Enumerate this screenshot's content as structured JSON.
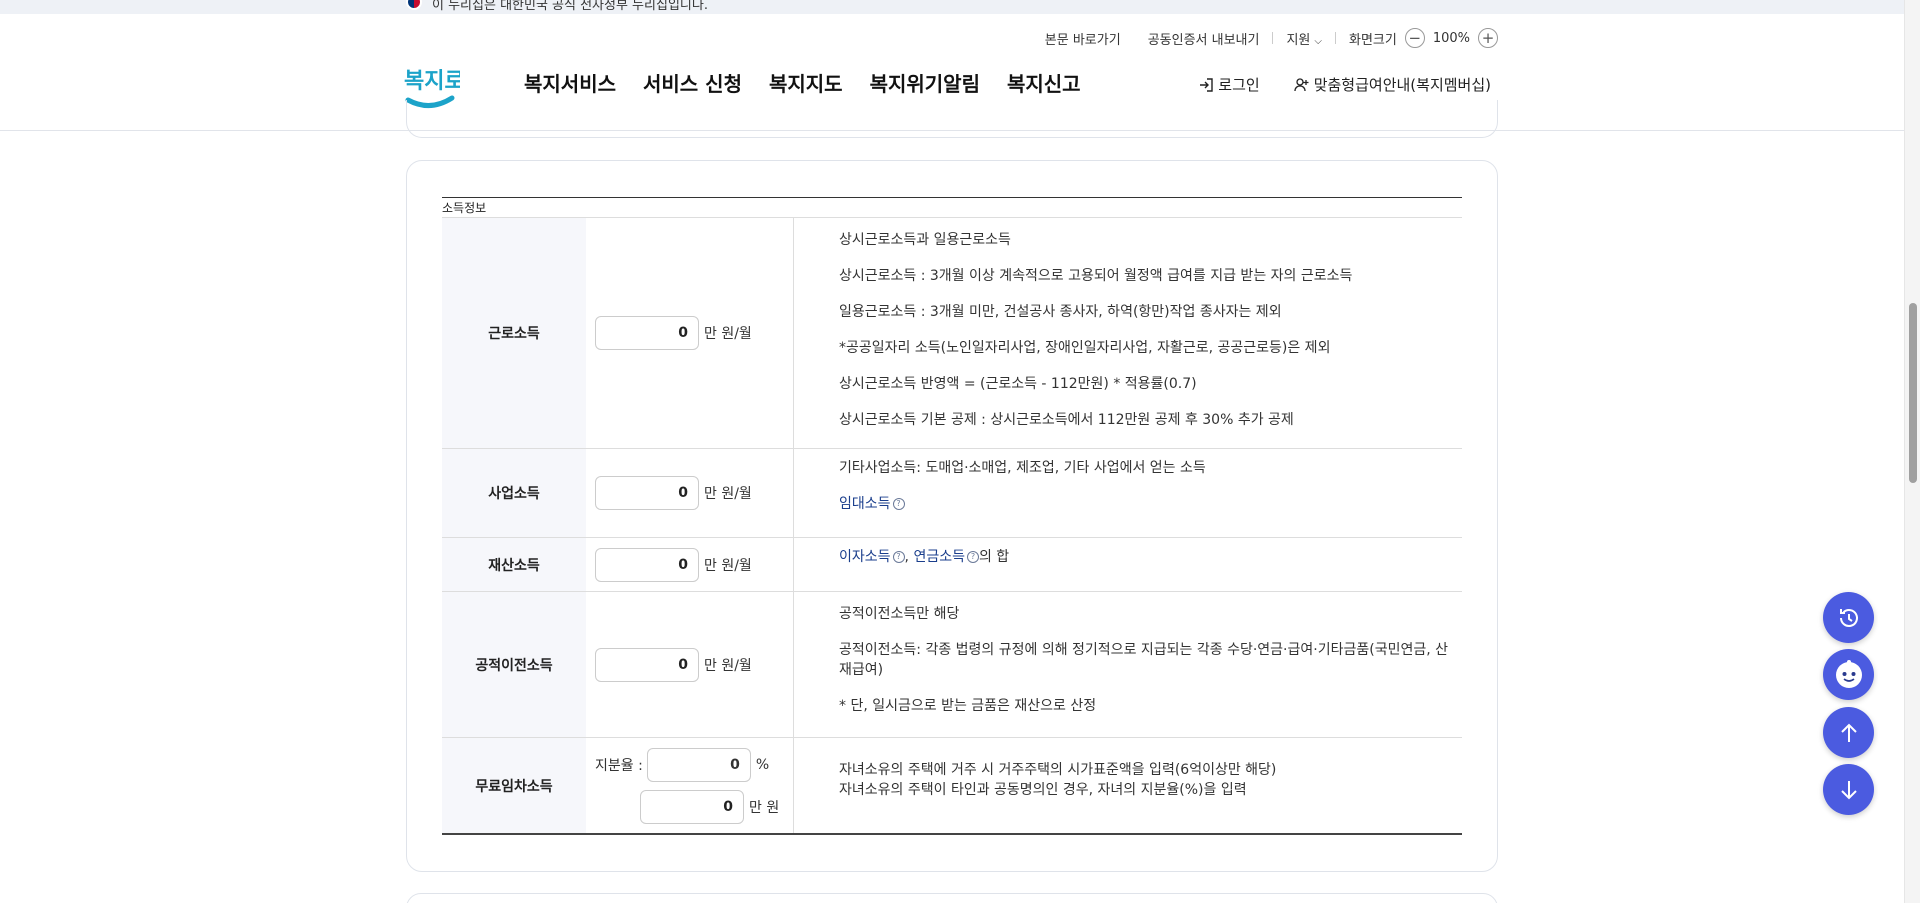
{
  "banner": {
    "text": "이 누리집은 대한민국 공식 전자정부 누리집입니다."
  },
  "util": {
    "skip_link": "본문 바로가기",
    "cert_export": "공동인증서 내보내기",
    "support": "지원",
    "zoom_label": "화면크기",
    "zoom_minus": "−",
    "zoom_value": "100%",
    "zoom_plus": "+"
  },
  "logo": {
    "text": "복지로"
  },
  "gnb": [
    {
      "label": "복지서비스"
    },
    {
      "label": "서비스 신청"
    },
    {
      "label": "복지지도"
    },
    {
      "label": "복지위기알림"
    },
    {
      "label": "복지신고"
    }
  ],
  "header_right": {
    "login": "로그인",
    "membership": "맞춤형급여안내(복지멤버십)"
  },
  "income": {
    "caption": "소득정보",
    "rows": [
      {
        "label": "근로소득",
        "value": "0",
        "unit": "만 원/월",
        "desc": [
          "상시근로소득과 일용근로소득",
          "상시근로소득 : 3개월 이상 계속적으로 고용되어 월정액 급여를 지급 받는 자의 근로소득",
          "일용근로소득 : 3개월 미만, 건설공사 종사자, 하역(항만)작업 종사자는 제외",
          "*공공일자리 소득(노인일자리사업, 장애인일자리사업, 자활근로, 공공근로등)은 제외",
          "상시근로소득 반영액 = (근로소득 - 112만원) * 적용률(0.7)",
          "상시근로소득 기본 공제 : 상시근로소득에서 112만원 공제 후 30% 추가 공제"
        ]
      },
      {
        "label": "사업소득",
        "value": "0",
        "unit": "만 원/월",
        "desc": [
          "기타사업소득: 도매업·소매업, 제조업, 기타 사업에서 얻는 소득"
        ],
        "link": "임대소득"
      },
      {
        "label": "재산소득",
        "value": "0",
        "unit": "만 원/월",
        "link1": "이자소득",
        "comma": ", ",
        "link2": "연금소득",
        "suffix": "의 합"
      },
      {
        "label": "공적이전소득",
        "value": "0",
        "unit": "만 원/월",
        "desc": [
          "공적이전소득만 해당",
          "공적이전소득: 각종 법령의 규정에 의해 정기적으로 지급되는 각종 수당·연금·급여·기타금품(국민연금, 산재급여)",
          "* 단, 일시금으로 받는 금품은 재산으로 산정"
        ]
      },
      {
        "label": "무료임차소득",
        "share_label": "지분율 :",
        "share_value": "0",
        "share_unit": "%",
        "value": "0",
        "unit": "만 원",
        "desc": [
          "자녀소유의 주택에 거주 시 거주주택의 시가표준액을 입력(6억이상만 해당)",
          "자녀소유의 주택이 타인과 공동명의인 경우, 자녀의 지분율(%)을 입력"
        ]
      }
    ],
    "help_glyph": "?"
  },
  "colors": {
    "accent": "#4b5be0",
    "link": "#1a3e8c",
    "header_bg": "#f6f7fb"
  }
}
